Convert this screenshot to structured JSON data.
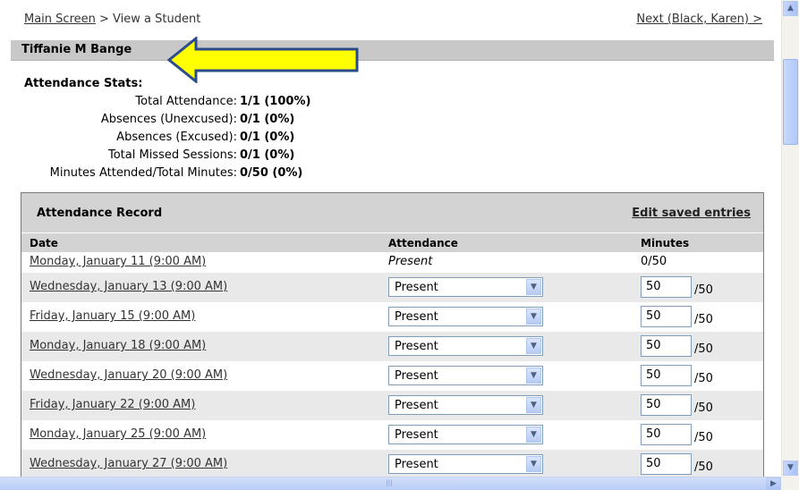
{
  "breadcrumb": {
    "home": "Main Screen",
    "separator": " > ",
    "current": "View a Student"
  },
  "next_link": "Next (Black, Karen) >",
  "student_name": "Tiffanie M Bange",
  "annotation": {
    "type": "arrow",
    "color": "#ffff00",
    "direction": "left"
  },
  "stats": {
    "heading": "Attendance Stats:",
    "items": [
      {
        "label": "Total Attendance:",
        "value": "1/1 (100%)"
      },
      {
        "label": "Absences (Unexcused):",
        "value": "0/1 (0%)"
      },
      {
        "label": "Absences (Excused):",
        "value": "0/1 (0%)"
      },
      {
        "label": "Total Missed Sessions:",
        "value": "0/1 (0%)"
      },
      {
        "label": "Minutes Attended/Total Minutes:",
        "value": "0/50 (0%)"
      }
    ]
  },
  "record": {
    "title": "Attendance Record",
    "edit_link": "Edit saved entries",
    "columns": {
      "date": "Date",
      "attendance": "Attendance",
      "minutes": "Minutes"
    },
    "rows": [
      {
        "date": "Monday, January 11 (9:00 AM)",
        "attendance": "Present",
        "minutes": "0/50"
      },
      {
        "date": "Wednesday, January 13 (9:00 AM)",
        "attendance": "Present",
        "minutes": "50",
        "total": "/50"
      },
      {
        "date": "Friday, January 15 (9:00 AM)",
        "attendance": "Present",
        "minutes": "50",
        "total": "/50"
      },
      {
        "date": "Monday, January 18 (9:00 AM)",
        "attendance": "Present",
        "minutes": "50",
        "total": "/50"
      },
      {
        "date": "Wednesday, January 20 (9:00 AM)",
        "attendance": "Present",
        "minutes": "50",
        "total": "/50"
      },
      {
        "date": "Friday, January 22 (9:00 AM)",
        "attendance": "Present",
        "minutes": "50",
        "total": "/50"
      },
      {
        "date": "Monday, January 25 (9:00 AM)",
        "attendance": "Present",
        "minutes": "50",
        "total": "/50"
      },
      {
        "date": "Wednesday, January 27 (9:00 AM)",
        "attendance": "Present",
        "minutes": "50",
        "total": "/50"
      }
    ]
  }
}
